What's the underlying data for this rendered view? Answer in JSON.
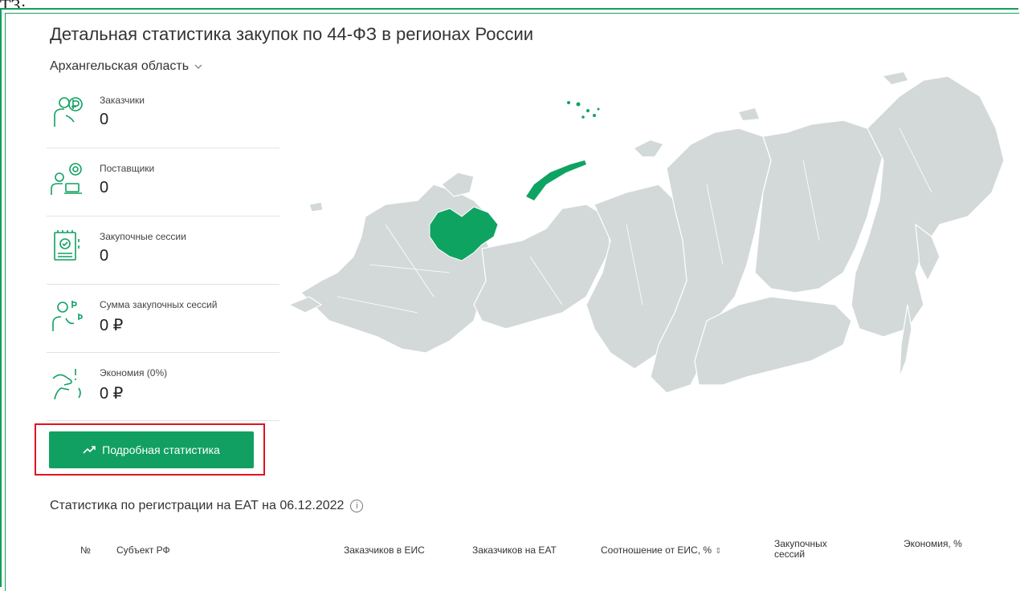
{
  "top_clip_text": "ТЗ:",
  "page_title": "Детальная статистика закупок по 44-ФЗ в регионах России",
  "region_select": {
    "label": "Архангельская область"
  },
  "stats": [
    {
      "label": "Заказчики",
      "value": "0",
      "icon": "customer-icon"
    },
    {
      "label": "Поставщики",
      "value": "0",
      "icon": "supplier-icon"
    },
    {
      "label": "Закупочные сессии",
      "value": "0",
      "icon": "sessions-icon"
    },
    {
      "label": "Сумма закупочных сессий",
      "value": "0 ₽",
      "icon": "sum-icon"
    },
    {
      "label": "Экономия (0%)",
      "value": "0 ₽",
      "icon": "savings-icon"
    }
  ],
  "details_button": {
    "label": "Подробная статистика",
    "icon": "trending-up-icon"
  },
  "registration": {
    "title": "Статистика по регистрации на ЕАТ на 06.12.2022",
    "info_icon": "info-icon"
  },
  "table": {
    "headers": {
      "num": "№",
      "subject": "Субъект РФ",
      "customers_eis": "Заказчиков в ЕИС",
      "customers_eat": "Заказчиков на ЕАТ",
      "ratio": "Соотношение от ЕИС, %",
      "sessions": "Закупочных сессий",
      "savings": "Экономия, %"
    }
  },
  "colors": {
    "accent": "#11a062",
    "highlight": "#e0131f",
    "map_fill": "#d3d9d9",
    "map_selected": "#0fa361"
  }
}
